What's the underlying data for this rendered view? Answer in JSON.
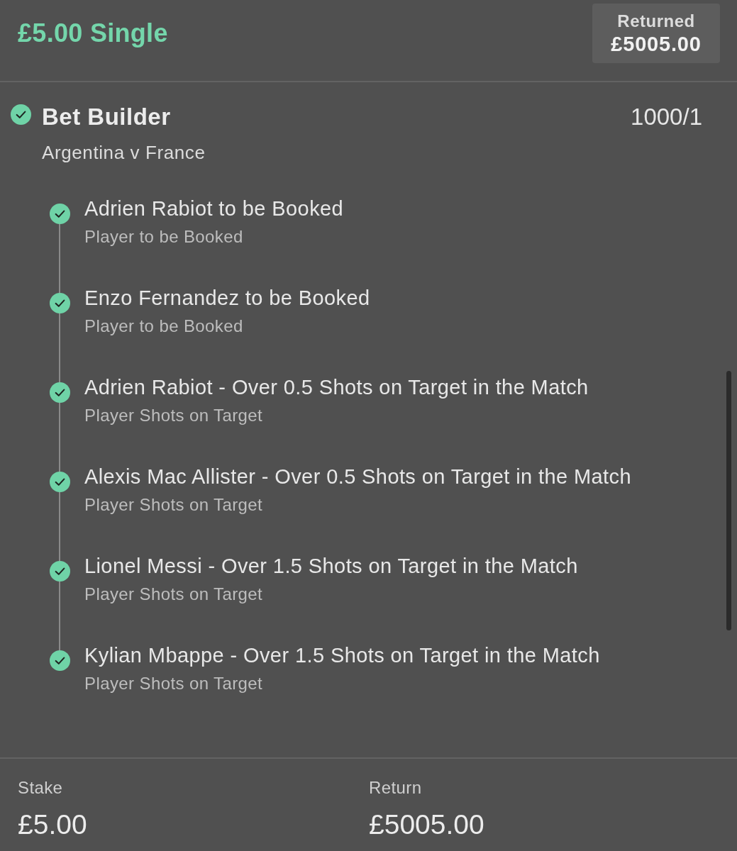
{
  "header": {
    "title": "£5.00 Single",
    "returned": {
      "label": "Returned",
      "amount": "£5005.00"
    }
  },
  "bet": {
    "won": true,
    "title": "Bet Builder",
    "odds": "1000/1",
    "event": "Argentina v France",
    "legs": [
      {
        "won": true,
        "selection": "Adrien Rabiot to be Booked",
        "market": "Player to be Booked"
      },
      {
        "won": true,
        "selection": "Enzo Fernandez to be Booked",
        "market": "Player to be Booked"
      },
      {
        "won": true,
        "selection": "Adrien Rabiot - Over 0.5 Shots on Target in the Match",
        "market": "Player Shots on Target"
      },
      {
        "won": true,
        "selection": "Alexis Mac Allister - Over 0.5 Shots on Target in the Match",
        "market": "Player Shots on Target"
      },
      {
        "won": true,
        "selection": "Lionel Messi - Over 1.5 Shots on Target in the Match",
        "market": "Player Shots on Target"
      },
      {
        "won": true,
        "selection": "Kylian Mbappe - Over 1.5 Shots on Target in the Match",
        "market": "Player Shots on Target"
      }
    ]
  },
  "summary": [
    {
      "label": "Stake",
      "value": "£5.00"
    },
    {
      "label": "Return",
      "value": "£5005.00"
    }
  ]
}
